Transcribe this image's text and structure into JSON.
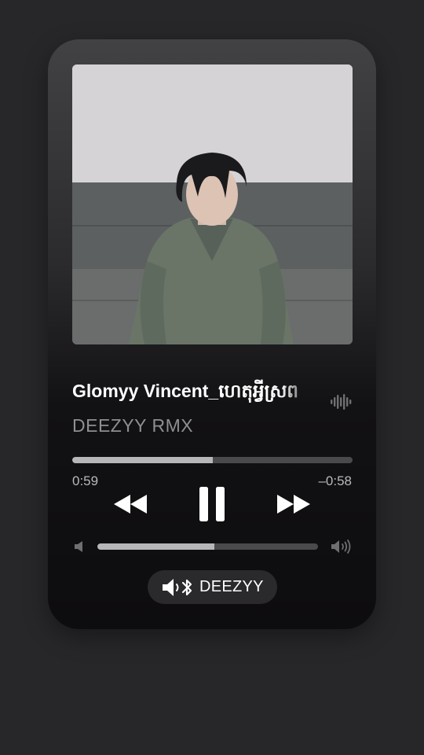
{
  "player": {
    "track_title": "Glomyy Vincent_ហេតុអ្វីស្រព",
    "artist": "DEEZYY RMX",
    "elapsed": "0:59",
    "remaining": "–0:58",
    "progress_fraction": 0.5,
    "volume_fraction": 0.53
  },
  "output_device": {
    "label": "DEEZYY",
    "icon": "speaker-bluetooth-icon"
  },
  "icons": {
    "wave": "waveform-icon",
    "rewind": "rewind-icon",
    "pause": "pause-icon",
    "forward": "fast-forward-icon",
    "volume_low": "volume-low-icon",
    "volume_high": "volume-high-icon"
  },
  "colors": {
    "background": "#272628",
    "text_primary": "#ffffff",
    "text_secondary": "#8f8e90",
    "track_fill": "#b7b6b8",
    "track_empty": "#4a494b"
  }
}
